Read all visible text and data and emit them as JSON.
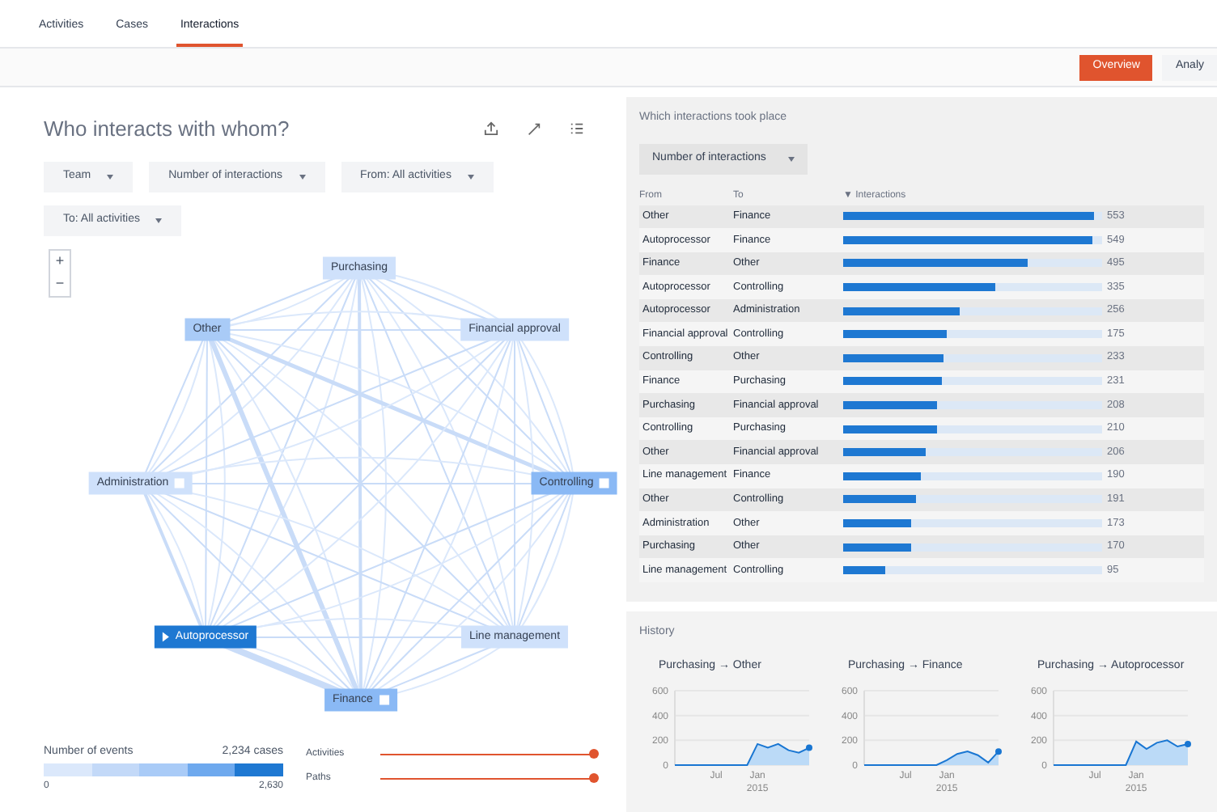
{
  "tabs": [
    {
      "label": "Activities",
      "selected": false
    },
    {
      "label": "Cases",
      "selected": false
    },
    {
      "label": "Interactions",
      "selected": true
    }
  ],
  "view_buttons": [
    {
      "label": "Overview",
      "selected": true
    },
    {
      "label": "Analy",
      "selected": false
    }
  ],
  "graph_panel": {
    "title": "Who interacts with whom?",
    "filters": [
      "Team",
      "Number of interactions",
      "From: All activities",
      "To: All activities"
    ],
    "zoom": [
      "+",
      "−"
    ],
    "nodes": [
      {
        "label": "Purchasing",
        "selected": false,
        "pinned": false,
        "color": "#cfe1fb"
      },
      {
        "label": "Other",
        "selected": false,
        "pinned": false,
        "color": "#a9cbf7"
      },
      {
        "label": "Financial approval",
        "selected": false,
        "pinned": false,
        "color": "#cfe1fb"
      },
      {
        "label": "Administration",
        "selected": false,
        "pinned": true,
        "color": "#cfe1fb"
      },
      {
        "label": "Controlling",
        "selected": false,
        "pinned": true,
        "color": "#8ab9f5"
      },
      {
        "label": "Autoprocessor",
        "selected": true,
        "pinned": false,
        "color": "#1e78d2"
      },
      {
        "label": "Line management",
        "selected": false,
        "pinned": false,
        "color": "#cfe1fb"
      },
      {
        "label": "Finance",
        "selected": false,
        "pinned": true,
        "color": "#8ab9f5"
      }
    ],
    "legend": {
      "title": "Number of events",
      "cases": "2,234 cases",
      "min": "0",
      "max": "2,630"
    },
    "sliders": [
      {
        "label": "Activities",
        "level": 1
      },
      {
        "label": "Paths",
        "level": 1
      }
    ]
  },
  "table_panel": {
    "title": "Which interactions took place",
    "metric": "Number of interactions",
    "columns": [
      "From",
      "To",
      "▼ Interactions"
    ],
    "rows": [
      {
        "from": "Other",
        "to": "Finance",
        "value": "553",
        "level": 0.97
      },
      {
        "from": "Autoprocessor",
        "to": "Finance",
        "value": "549",
        "level": 0.96
      },
      {
        "from": "Finance",
        "to": "Other",
        "value": "495",
        "level": 0.71
      },
      {
        "from": "Autoprocessor",
        "to": "Controlling",
        "value": "335",
        "level": 0.59
      },
      {
        "from": "Autoprocessor",
        "to": "Administration",
        "value": "256",
        "level": 0.45
      },
      {
        "from": "Financial approval",
        "to": "Controlling",
        "value": "175",
        "level": 0.4
      },
      {
        "from": "Controlling",
        "to": "Other",
        "value": "233",
        "level": 0.39
      },
      {
        "from": "Finance",
        "to": "Purchasing",
        "value": "231",
        "level": 0.38
      },
      {
        "from": "Purchasing",
        "to": "Financial approval",
        "value": "208",
        "level": 0.36
      },
      {
        "from": "Controlling",
        "to": "Purchasing",
        "value": "210",
        "level": 0.36
      },
      {
        "from": "Other",
        "to": "Financial approval",
        "value": "206",
        "level": 0.32
      },
      {
        "from": "Line management",
        "to": "Finance",
        "value": "190",
        "level": 0.3
      },
      {
        "from": "Other",
        "to": "Controlling",
        "value": "191",
        "level": 0.28
      },
      {
        "from": "Administration",
        "to": "Other",
        "value": "173",
        "level": 0.26
      },
      {
        "from": "Purchasing",
        "to": "Other",
        "value": "170",
        "level": 0.26
      },
      {
        "from": "Line management",
        "to": "Controlling",
        "value": "95",
        "level": 0.16
      }
    ]
  },
  "history": {
    "title": "History",
    "charts": [
      {
        "year": "2015",
        "chart_data": {
          "type": "area",
          "title": "Purchasing → Other",
          "categories": [
            null,
            null,
            null,
            null,
            "Jul",
            null,
            null,
            null,
            "Jan",
            null,
            null,
            null,
            null,
            null
          ],
          "series": [
            {
              "color": "#1976d2",
              "values": [
                0,
                0,
                0,
                0,
                0,
                0,
                0,
                0,
                170,
                140,
                170,
                120,
                100,
                140
              ]
            }
          ],
          "ylim": [
            0,
            600
          ],
          "yticks": [
            0,
            200,
            400,
            600
          ]
        }
      },
      {
        "year": "2015",
        "chart_data": {
          "type": "area",
          "title": "Purchasing → Finance",
          "categories": [
            null,
            null,
            null,
            null,
            "Jul",
            null,
            null,
            null,
            "Jan",
            null,
            null,
            null,
            null,
            null
          ],
          "series": [
            {
              "color": "#1976d2",
              "values": [
                0,
                0,
                0,
                0,
                0,
                0,
                0,
                0,
                40,
                90,
                110,
                80,
                20,
                110
              ]
            }
          ],
          "ylim": [
            0,
            600
          ],
          "yticks": [
            0,
            200,
            400,
            600
          ]
        }
      },
      {
        "year": "2015",
        "chart_data": {
          "type": "area",
          "title": "Purchasing → Autoprocessor",
          "categories": [
            null,
            null,
            null,
            null,
            "Jul",
            null,
            null,
            null,
            "Jan",
            null,
            null,
            null,
            null,
            null
          ],
          "series": [
            {
              "color": "#1976d2",
              "values": [
                0,
                0,
                0,
                0,
                0,
                0,
                0,
                0,
                190,
                130,
                180,
                200,
                150,
                170
              ]
            }
          ],
          "ylim": [
            0,
            600
          ],
          "yticks": [
            0,
            200,
            400,
            600
          ]
        }
      }
    ]
  }
}
